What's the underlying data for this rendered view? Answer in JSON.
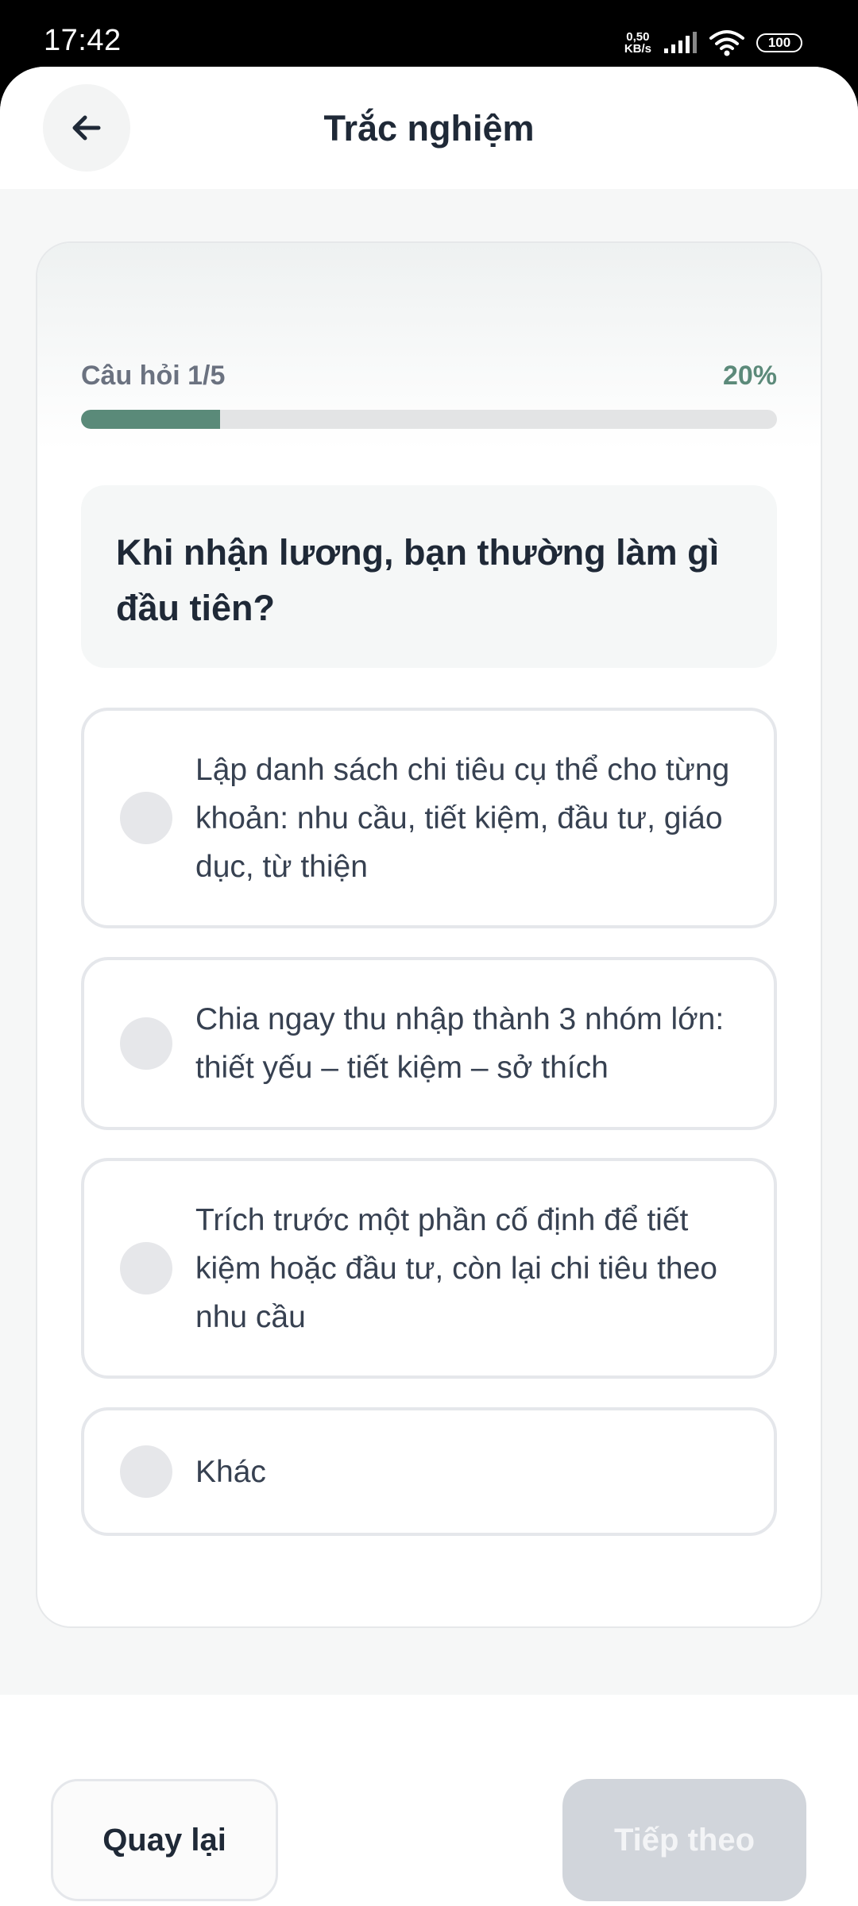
{
  "status_bar": {
    "time": "17:42",
    "net_speed_value": "0,50",
    "net_speed_unit": "KB/s",
    "battery": "100"
  },
  "header": {
    "title": "Trắc nghiệm",
    "back_icon": "arrow-left-icon"
  },
  "quiz": {
    "counter_label": "Câu hỏi 1/5",
    "percent_label": "20%",
    "progress": 0.2,
    "accent_color": "#5a8a79",
    "question": "Khi nhận lương, bạn thường làm gì đầu tiên?",
    "options": [
      {
        "label": "Lập danh sách chi tiêu cụ thể cho từng khoản: nhu cầu, tiết kiệm, đầu tư, giáo dục, từ thiện",
        "selected": false
      },
      {
        "label": "Chia ngay thu nhập thành 3 nhóm lớn: thiết yếu – tiết kiệm – sở thích",
        "selected": false
      },
      {
        "label": "Trích trước một phần cố định để tiết kiệm hoặc đầu tư, còn lại chi tiêu theo nhu cầu",
        "selected": false
      },
      {
        "label": "Khác",
        "selected": false
      }
    ]
  },
  "footer": {
    "back_label": "Quay lại",
    "next_label": "Tiếp theo",
    "next_disabled": true
  }
}
